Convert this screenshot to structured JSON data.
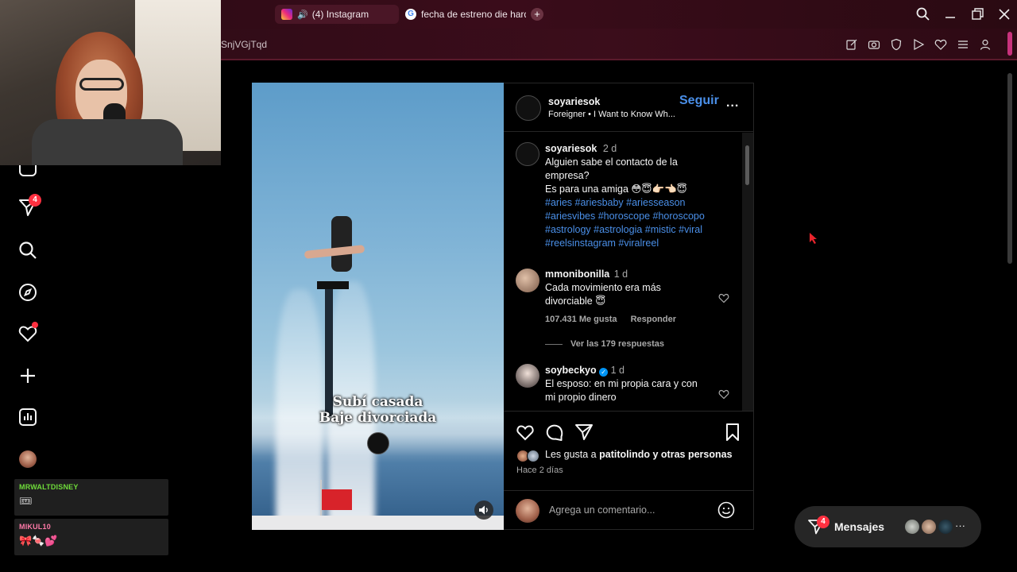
{
  "browser": {
    "tabs": [
      {
        "label": "(4) Instagram"
      },
      {
        "label": "fecha de estreno die hard"
      }
    ],
    "url_fragment": "SnjVGjTqd",
    "new_tab": "+"
  },
  "sidebar": {
    "notifications_badge": "4",
    "chats": [
      {
        "name": "MRWALTDISNEY",
        "color": "#6fdc3a",
        "emoji": "🎟"
      },
      {
        "name": "MIKUL10",
        "color": "#ff7aa8",
        "emoji": "🎀🍬💕"
      }
    ]
  },
  "post": {
    "username": "soyariesok",
    "follow": "Seguir",
    "audio": "Foreigner • I Want to Know Wh...",
    "more": "...",
    "overlay_line1": "Subí casada",
    "overlay_line2": "Baje divorciada",
    "caption": {
      "username": "soyariesok",
      "time": "2 d",
      "line1": "Alguien sabe el contacto de la",
      "line2": "empresa?",
      "line3": "Es para una amiga 😳😇👉🏻👈🏻😇",
      "hashtags1": "#aries #ariesbaby #ariesseason",
      "hashtags2": "#ariesvibes #horoscope #horoscopo",
      "hashtags3": "#astrology #astrologia #mistic #viral",
      "hashtags4": "#reelsinstagram #viralreel"
    },
    "comments": [
      {
        "username": "mmonibonilla",
        "time": "1 d",
        "line1": "Cada movimiento era más",
        "line2": "divorciable 😇",
        "likes": "107.431 Me gusta",
        "reply": "Responder",
        "view_replies": "Ver las 179 respuestas"
      },
      {
        "username": "soybeckyo",
        "time": "1 d",
        "line1": "El esposo: en mi propia cara y con",
        "line2": "mi propio dinero"
      }
    ],
    "liked_by_prefix": "Les gusta a",
    "liked_by_user": "patitolindo",
    "liked_by_suffix": "y otras personas",
    "posted": "Hace 2 días",
    "comment_placeholder": "Agrega un comentario..."
  },
  "messages": {
    "label": "Mensajes",
    "badge": "4",
    "more": "···"
  },
  "colors": {
    "accent": "#0095f6",
    "badge": "#ff3040",
    "link": "#4a8fe8"
  }
}
